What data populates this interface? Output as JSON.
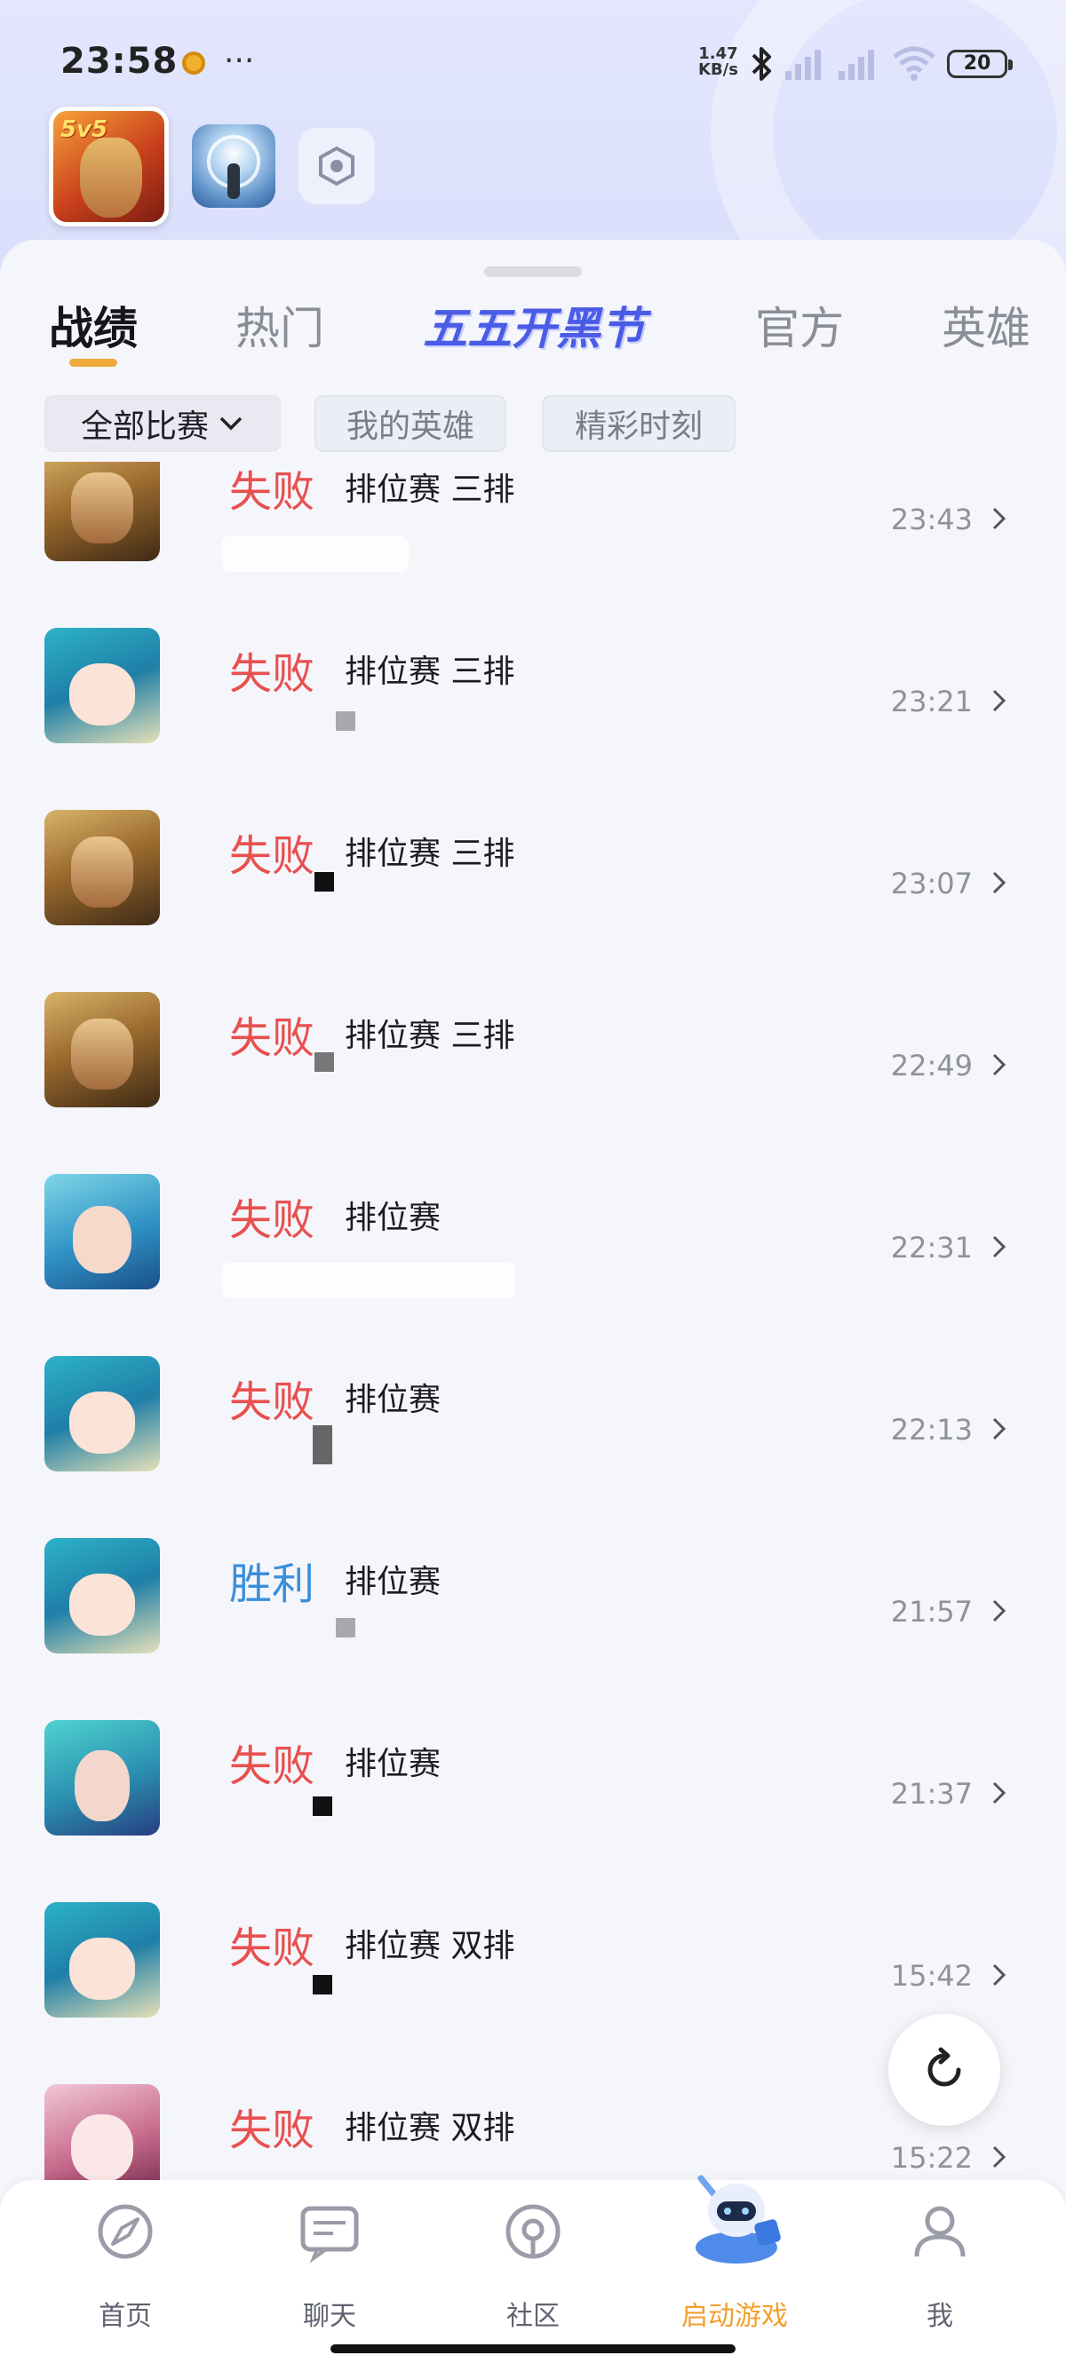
{
  "status": {
    "time": "23:58",
    "net_speed_top": "1.47",
    "net_speed_unit": "KB/s",
    "battery": "20"
  },
  "tabs": [
    {
      "label": "战绩"
    },
    {
      "label": "热门"
    },
    {
      "label": "五五开黑节"
    },
    {
      "label": "官方"
    },
    {
      "label": "英雄"
    }
  ],
  "filters": {
    "all_matches": "全部比赛",
    "my_heroes": "我的英雄",
    "highlights": "精彩时刻"
  },
  "matches": [
    {
      "result": "失败",
      "mode": "排位赛 三排",
      "time": "23:43",
      "avatar": "gold-hero"
    },
    {
      "result": "失败",
      "mode": "排位赛 三排",
      "time": "23:21",
      "avatar": "teal-hero"
    },
    {
      "result": "失败",
      "mode": "排位赛 三排",
      "time": "23:07",
      "avatar": "gold-hero"
    },
    {
      "result": "失败",
      "mode": "排位赛 三排",
      "time": "22:49",
      "avatar": "gold-hero"
    },
    {
      "result": "失败",
      "mode": "排位赛",
      "time": "22:31",
      "avatar": "sea-hero"
    },
    {
      "result": "失败",
      "mode": "排位赛",
      "time": "22:13",
      "avatar": "teal-hero"
    },
    {
      "result": "胜利",
      "mode": "排位赛",
      "time": "21:57",
      "avatar": "teal-hero"
    },
    {
      "result": "失败",
      "mode": "排位赛",
      "time": "21:37",
      "avatar": "aqua-hero"
    },
    {
      "result": "失败",
      "mode": "排位赛 双排",
      "time": "15:42",
      "avatar": "teal-hero"
    },
    {
      "result": "失败",
      "mode": "排位赛 双排",
      "time": "15:22",
      "avatar": "pink-hero"
    }
  ],
  "bottom_nav": [
    {
      "label": "首页",
      "icon": "compass-icon"
    },
    {
      "label": "聊天",
      "icon": "chat-icon"
    },
    {
      "label": "社区",
      "icon": "community-icon"
    },
    {
      "label": "启动游戏",
      "icon": "launch-game-icon"
    },
    {
      "label": "我",
      "icon": "profile-icon"
    }
  ],
  "colors": {
    "lose": "#e8504f",
    "win": "#3a8fdc",
    "accent": "#f0a93a",
    "promo": "#4a5be6"
  }
}
